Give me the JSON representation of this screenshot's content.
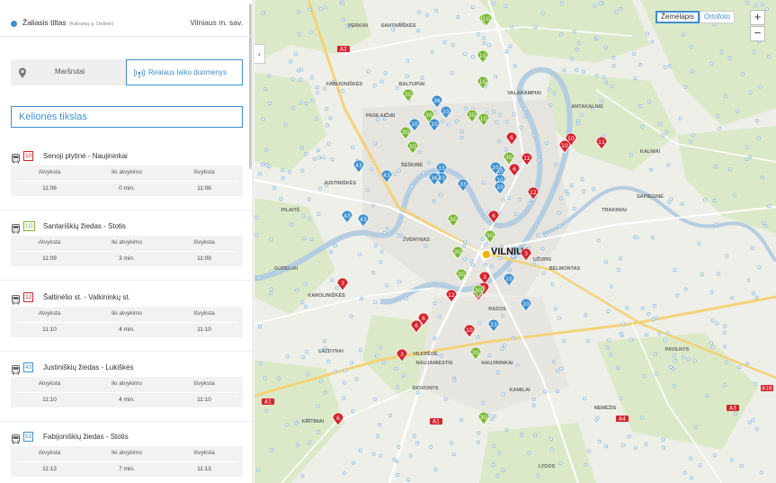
{
  "stop": {
    "name": "Žaliasis tiltas",
    "sub": "(Kalvarijų g. Dešinė)",
    "city": "Vilniaus m. sav."
  },
  "tabs": {
    "routes": "Maršrutai",
    "realtime": "Realaus laiko duomenys"
  },
  "destination": {
    "placeholder": "Kelionės tikslas"
  },
  "columns": {
    "arrive": "Atvyksta",
    "until": "Iki atvykimo",
    "depart": "Išvyksta"
  },
  "departures": [
    {
      "route": "10",
      "color": "#d4232d",
      "dest": "Senoji plytinė - Naujininkai",
      "arrive": "11:06",
      "until": "0 min.",
      "depart": "11:06"
    },
    {
      "route": "1G",
      "color": "#7ab833",
      "dest": "Santariškių žiedas - Stotis",
      "arrive": "11:09",
      "until": "3 min.",
      "depart": "11:09"
    },
    {
      "route": "12",
      "color": "#d4232d",
      "dest": "Šaltinėlio st. - Valkininkų st.",
      "arrive": "11:10",
      "until": "4 min.",
      "depart": "11:10"
    },
    {
      "route": "43",
      "color": "#3d8fd0",
      "dest": "Justiniškių žiedas - Lukiškės",
      "arrive": "11:10",
      "until": "4 min.",
      "depart": "11:10"
    },
    {
      "route": "53",
      "color": "#3d8fd0",
      "dest": "Fabijoniškių žiedas - Stotis",
      "arrive": "11:13",
      "until": "7 min.",
      "depart": "11:13"
    }
  ],
  "map": {
    "type_map": "Žemėlapis",
    "type_ortho": "Ortofoto",
    "zoom_in": "+",
    "zoom_out": "−",
    "collapse": "‹",
    "city": "VILNIUS",
    "districts": [
      "VERKIAI",
      "VALAKAMPIAI",
      "BALTUPIAI",
      "ANTAKALNIS",
      "ŠEŠKINĖ",
      "JUSTINIŠKĖS",
      "ŽVĖRYNAS",
      "PILAITĖ",
      "KAROLINIŠKĖS",
      "LAZDYNAI",
      "VILKPĖDĖ",
      "NAUJAMIESTIS",
      "NAUJININKAI",
      "RASOS",
      "UŽUPIS",
      "BELMONTAS",
      "PAVILNYS",
      "KAMILAI",
      "NEMĖŽIS",
      "SANTARIŠKĖS",
      "FABIJONIŠKĖS",
      "PASILAIČIAI",
      "TRAKINIAI",
      "KALNIAI",
      "SAPIEGINĖ",
      "GUDELIAI",
      "KIRTIMAI",
      "LYDOS",
      "RIOVONYS"
    ],
    "road_shields": [
      "A2",
      "A1",
      "A1",
      "A4",
      "A16",
      "A3"
    ],
    "markers": [
      {
        "label": "1G",
        "color": "#7ab833",
        "kind": "pin"
      },
      {
        "label": "1G",
        "color": "#7ab833",
        "kind": "pin"
      },
      {
        "label": "1G",
        "color": "#7ab833",
        "kind": "pin"
      },
      {
        "label": "3G",
        "color": "#7ab833",
        "kind": "pin"
      },
      {
        "label": "3G",
        "color": "#7ab833",
        "kind": "pin"
      },
      {
        "label": "3G",
        "color": "#7ab833",
        "kind": "pin"
      },
      {
        "label": "3G",
        "color": "#7ab833",
        "kind": "pin"
      },
      {
        "label": "3G",
        "color": "#7ab833",
        "kind": "pin"
      },
      {
        "label": "3G",
        "color": "#7ab833",
        "kind": "pin"
      },
      {
        "label": "3G",
        "color": "#7ab833",
        "kind": "pin"
      },
      {
        "label": "3G",
        "color": "#7ab833",
        "kind": "pin"
      },
      {
        "label": "1G",
        "color": "#7ab833",
        "kind": "pin"
      },
      {
        "label": "1G",
        "color": "#7ab833",
        "kind": "pin"
      },
      {
        "label": "3G",
        "color": "#7ab833",
        "kind": "pin"
      },
      {
        "label": "10",
        "color": "#3d8fd0",
        "kind": "pin"
      },
      {
        "label": "10",
        "color": "#3d8fd0",
        "kind": "pin"
      },
      {
        "label": "10",
        "color": "#3d8fd0",
        "kind": "pin"
      },
      {
        "label": "10",
        "color": "#3d8fd0",
        "kind": "pin"
      },
      {
        "label": "10",
        "color": "#3d8fd0",
        "kind": "pin"
      },
      {
        "label": "10",
        "color": "#3d8fd0",
        "kind": "pin"
      },
      {
        "label": "36",
        "color": "#3d8fd0",
        "kind": "pin"
      },
      {
        "label": "43",
        "color": "#3d8fd0",
        "kind": "pin"
      },
      {
        "label": "43",
        "color": "#3d8fd0",
        "kind": "pin"
      },
      {
        "label": "43",
        "color": "#3d8fd0",
        "kind": "pin"
      },
      {
        "label": "43",
        "color": "#3d8fd0",
        "kind": "pin"
      },
      {
        "label": "33",
        "color": "#3d8fd0",
        "kind": "pin"
      },
      {
        "label": "33",
        "color": "#3d8fd0",
        "kind": "pin"
      },
      {
        "label": "36",
        "color": "#3d8fd0",
        "kind": "pin"
      },
      {
        "label": "33",
        "color": "#3d8fd0",
        "kind": "pin"
      },
      {
        "label": "10",
        "color": "#3d8fd0",
        "kind": "pin"
      },
      {
        "label": "6",
        "color": "#d4232d",
        "kind": "pin"
      },
      {
        "label": "12",
        "color": "#d4232d",
        "kind": "pin"
      },
      {
        "label": "6",
        "color": "#d4232d",
        "kind": "pin"
      },
      {
        "label": "12",
        "color": "#d4232d",
        "kind": "pin"
      },
      {
        "label": "10",
        "color": "#d4232d",
        "kind": "pin"
      },
      {
        "label": "10",
        "color": "#d4232d",
        "kind": "pin"
      },
      {
        "label": "11",
        "color": "#d4232d",
        "kind": "pin"
      },
      {
        "label": "6",
        "color": "#d4232d",
        "kind": "pin"
      },
      {
        "label": "3",
        "color": "#d4232d",
        "kind": "pin"
      },
      {
        "label": "3",
        "color": "#d4232d",
        "kind": "pin"
      },
      {
        "label": "3",
        "color": "#d4232d",
        "kind": "pin"
      },
      {
        "label": "6",
        "color": "#d4232d",
        "kind": "pin"
      },
      {
        "label": "12",
        "color": "#d4232d",
        "kind": "pin"
      },
      {
        "label": "6",
        "color": "#d4232d",
        "kind": "pin"
      },
      {
        "label": "6",
        "color": "#d4232d",
        "kind": "pin"
      },
      {
        "label": "10",
        "color": "#d4232d",
        "kind": "pin"
      },
      {
        "label": "3",
        "color": "#d4232d",
        "kind": "pin"
      },
      {
        "label": "6",
        "color": "#d4232d",
        "kind": "pin"
      },
      {
        "label": "3",
        "color": "#d4232d",
        "kind": "pin"
      },
      {
        "label": "3G",
        "color": "#7ab833",
        "kind": "pin"
      },
      {
        "label": "3G",
        "color": "#7ab833",
        "kind": "pin"
      },
      {
        "label": "3G",
        "color": "#7ab833",
        "kind": "pin"
      },
      {
        "label": "3G",
        "color": "#7ab833",
        "kind": "pin"
      },
      {
        "label": "10",
        "color": "#3d8fd0",
        "kind": "pin"
      },
      {
        "label": "33",
        "color": "#3d8fd0",
        "kind": "pin"
      },
      {
        "label": "10",
        "color": "#3d8fd0",
        "kind": "pin"
      }
    ]
  },
  "colors": {
    "accent": "#3d8fd0",
    "bus_red": "#d4232d",
    "bus_green": "#7ab833",
    "bus_blue": "#3d8fd0",
    "selected_stop": "#f5b400"
  }
}
